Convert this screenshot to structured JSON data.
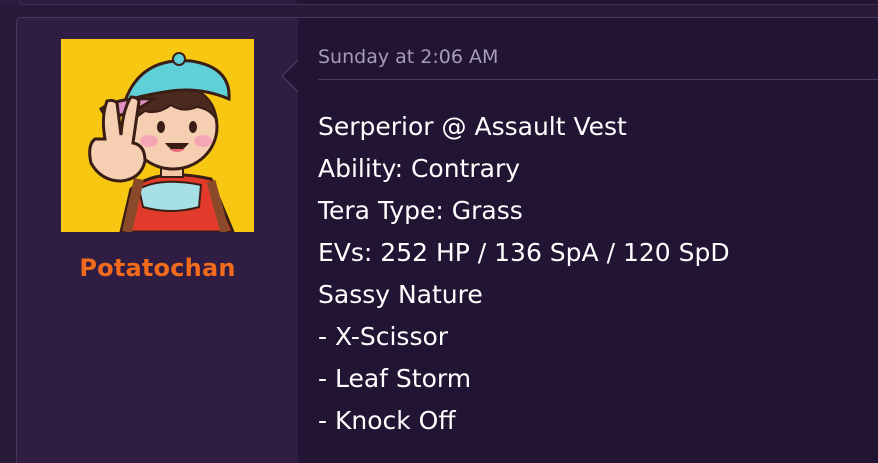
{
  "post": {
    "username": "Potatochan",
    "timestamp": "Sunday at 2:06 AM",
    "lines": [
      "Serperior @ Assault Vest",
      "Ability: Contrary",
      "Tera Type: Grass",
      "EVs: 252 HP / 136 SpA / 120 SpD",
      "Sassy Nature",
      "- X-Scissor",
      "- Leaf Storm",
      "- Knock Off"
    ]
  },
  "colors": {
    "background": "#2a1a3a",
    "user_cell": "#2f1d44",
    "content_cell": "#221533",
    "border": "#4a3760",
    "username": "#f26a1b",
    "timestamp": "#a69cb6",
    "text": "#ffffff",
    "avatar_bg": "#f7c712"
  },
  "icons": {
    "avatar": "cartoon-character-peace-sign-avatar"
  }
}
